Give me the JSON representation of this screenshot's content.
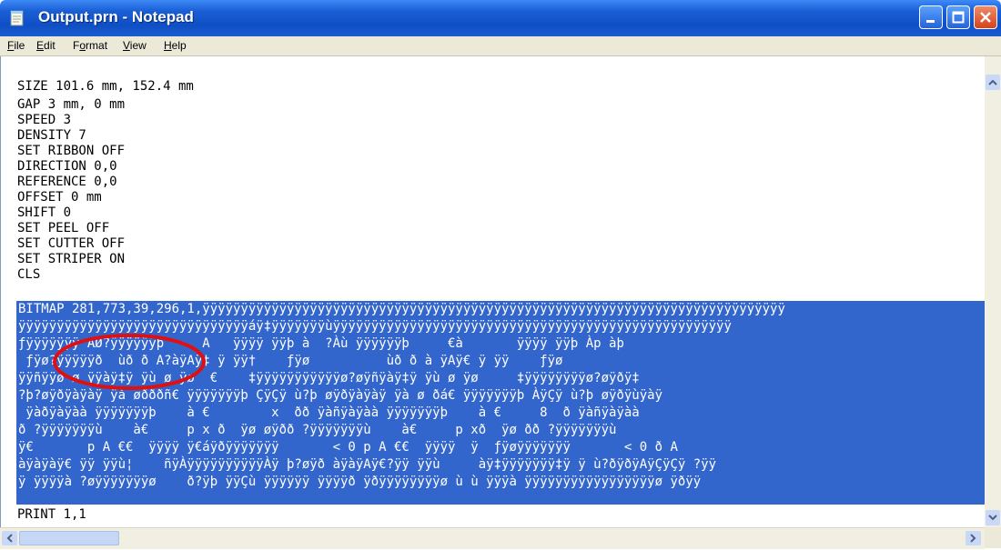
{
  "window": {
    "title": "Output.prn - Notepad"
  },
  "menu": [
    {
      "mn": "F",
      "rest": "ile"
    },
    {
      "mn": "E",
      "rest": "dit"
    },
    {
      "pre": "F",
      "mn": "o",
      "rest": "rmat"
    },
    {
      "mn": "V",
      "rest": "iew"
    },
    {
      "mn": "H",
      "rest": "elp"
    }
  ],
  "editor": {
    "plain_lines": [
      "SIZE 101.6 mm, 152.4 mm",
      "GAP 3 mm, 0 mm",
      "SPEED 3",
      "DENSITY 7",
      "SET RIBBON OFF",
      "DIRECTION 0,0",
      "REFERENCE 0,0",
      "OFFSET 0 mm",
      "SHIFT 0",
      "SET PEEL OFF",
      "SET CUTTER OFF",
      "SET STRIPER ON",
      "CLS"
    ],
    "selected_lines": [
      "BITMAP 281,773,39,296,1,ÿÿÿÿÿÿÿÿÿÿÿÿÿÿÿÿÿÿÿÿÿÿÿÿÿÿÿÿÿÿÿÿÿÿÿÿÿÿÿÿÿÿÿÿÿÿÿÿÿÿÿÿÿÿÿÿÿÿÿÿÿÿÿÿÿÿÿÿÿÿÿÿÿÿÿÿ",
      "ÿÿÿÿÿÿÿÿÿÿÿÿÿÿÿÿÿÿÿÿÿÿÿÿÿÿÿÿÿÿáÿ‡ÿÿÿÿÿÿÿùÿÿÿÿÿÿÿÿÿÿÿÿÿÿÿÿÿÿÿÿÿÿÿÿÿÿÿÿÿÿÿÿÿÿÿÿÿÿÿÿÿÿÿÿÿÿÿÿÿÿÿÿ",
      "ƒÿÿÿÿÿÿÿ AØ?ÿÿÿÿÿÿþ     A   ÿÿÿÿ ÿÿþ à  ?Àù ÿÿÿÿÿÿþ     €à       ÿÿÿÿ ÿÿþ Àp àþ",
      " ƒÿø?ÿÿÿÿÿð  ùð ð A?àÿAÿ‡ ÿ ÿÿ†    ƒÿø          ùð ð à ÿAÿ€ ÿ ÿÿ    ƒÿø",
      "ÿÿñÿÿø ø ÿÿàÿ‡ÿ ÿù ø ÿø  €    ‡ÿÿÿÿÿÿÿÿÿÿÿø?øÿñÿàÿ‡ÿ ÿù ø ÿø     ‡ÿÿÿÿÿÿÿÿø?øÿðÿ‡",
      "?þ?øÿðÿàÿàÿ ÿà øðððñ€ ÿÿÿÿÿÿÿþ ÇÿÇÿ ù?þ øÿðÿàÿàÿ ÿà ø ðá€ ÿÿÿÿÿÿÿþ ÀÿÇÿ ù?þ øÿðÿùÿàÿ",
      " ÿàðÿàÿàà ÿÿÿÿÿÿÿþ    à €        x  ðð ÿàñÿàÿàà ÿÿÿÿÿÿÿþ    à €     8  ð ÿàñÿàÿàà",
      "ð ?ÿÿÿÿÿÿÿù    à€     p x ð  ÿø øÿðð ?ÿÿÿÿÿÿÿù    à€     p xð  ÿø ðð ?ÿÿÿÿÿÿÿù",
      "ÿ€       p A €€  ÿÿÿÿ ÿ€áÿðÿÿÿÿÿÿÿ       < 0 p A €€  ÿÿÿÿ  ÿ  ƒÿøÿÿÿÿÿÿÿ       < 0 ð A",
      "àÿàÿàÿ€ ÿÿ ÿÿù¦    ñÿÀÿÿÿÿÿÿÿÿÿÿÀÿ þ?øÿð àÿàÿAÿ€?ÿÿ ÿÿù     àÿ‡ÿÿÿÿÿÿÿ‡ÿ ÿ ù?ðÿðÿAÿÇÿÇÿ ?ÿÿ",
      "ÿ ÿÿÿÿà ?øÿÿÿÿÿÿÿø    ð?ÿþ ÿÿÇù ÿÿÿÿÿÿ ÿÿÿÿð ÿðÿÿÿÿÿÿÿÿø ù ù ÿÿÿà ÿÿÿÿÿÿÿÿÿÿÿÿÿÿÿÿÿø ÿðÿÿ"
    ],
    "last_line": "PRINT 1,1"
  },
  "colors": {
    "selection": "#3366cc",
    "annotation_circle": "#e01010"
  }
}
